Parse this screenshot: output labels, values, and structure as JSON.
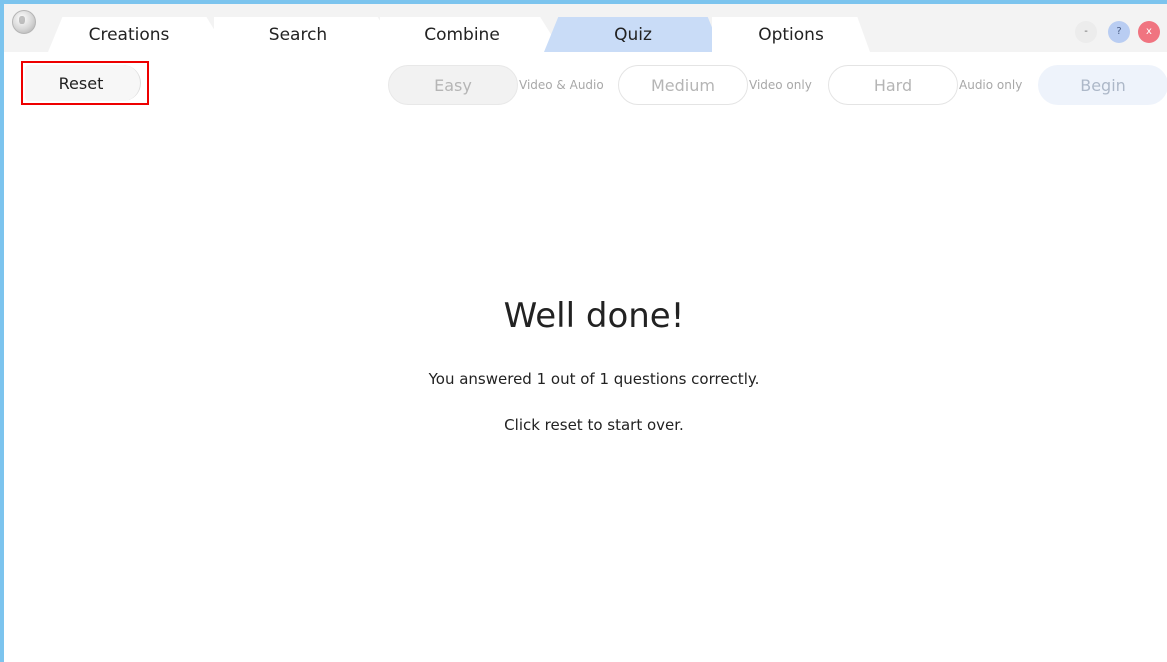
{
  "tabs": [
    {
      "label": "Creations",
      "active": false
    },
    {
      "label": "Search",
      "active": false
    },
    {
      "label": "Combine",
      "active": false
    },
    {
      "label": "Quiz",
      "active": true
    },
    {
      "label": "Options",
      "active": false
    }
  ],
  "window_controls": {
    "minimize": "-",
    "help": "?",
    "close": "x"
  },
  "toolbar": {
    "reset_label": "Reset",
    "modes": [
      {
        "label": "Easy",
        "description": "Video & Audio"
      },
      {
        "label": "Medium",
        "description": "Video only"
      },
      {
        "label": "Hard",
        "description": "Audio only"
      }
    ],
    "begin_label": "Begin"
  },
  "result": {
    "headline": "Well done!",
    "score_text": "You answered 1 out of 1 questions correctly.",
    "hint_text": "Click reset to start over."
  },
  "icons": {
    "app_logo": "globe-logo-icon"
  },
  "colors": {
    "window_border": "#7cc4ee",
    "active_tab": "#c9dcf7",
    "reset_highlight": "#ee0000",
    "close_button": "#f07480",
    "help_button": "#b9cdf2"
  }
}
